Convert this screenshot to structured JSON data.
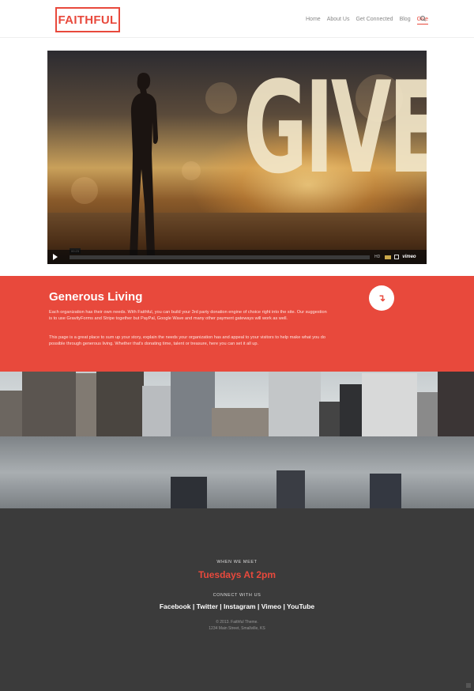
{
  "header": {
    "logo": "FAITHFUL",
    "nav": [
      "Home",
      "About Us",
      "Get Connected",
      "Blog",
      "Give"
    ],
    "active_nav": "Give"
  },
  "video": {
    "overlay_word": "GIVE",
    "timecode": "00:23",
    "hd_label": "HD",
    "brand": "vimeo"
  },
  "give_section": {
    "title": "Generous Living",
    "paragraph1": "Each organization has their own needs. With Faithful, you can build your 3rd party donation engine of choice right into the site. Our suggestion is to use GravityForms and Stripe together but PayPal, Google Wave and many other payment gateways will work as well.",
    "paragraph2": "This page is a great place to sum up your story, explain the needs your organization has and appeal to your visitors to help make what you do possible through generous living. Whether that's donating time, talent or treasure, here you can set it all up.",
    "button_icon": "arrow-down-icon",
    "button_glyph": "↴",
    "accent_color": "#e8493c"
  },
  "footer": {
    "meet_label": "WHEN WE MEET",
    "meet_time": "Tuesdays At 2pm",
    "connect_label": "CONNECT WITH US",
    "social": [
      "Facebook",
      "Twitter",
      "Instagram",
      "Vimeo",
      "YouTube"
    ],
    "separator": " | ",
    "copyright": "© 2013. Faithful Theme.",
    "address": "1234 Main Street, Smallville, KS"
  }
}
